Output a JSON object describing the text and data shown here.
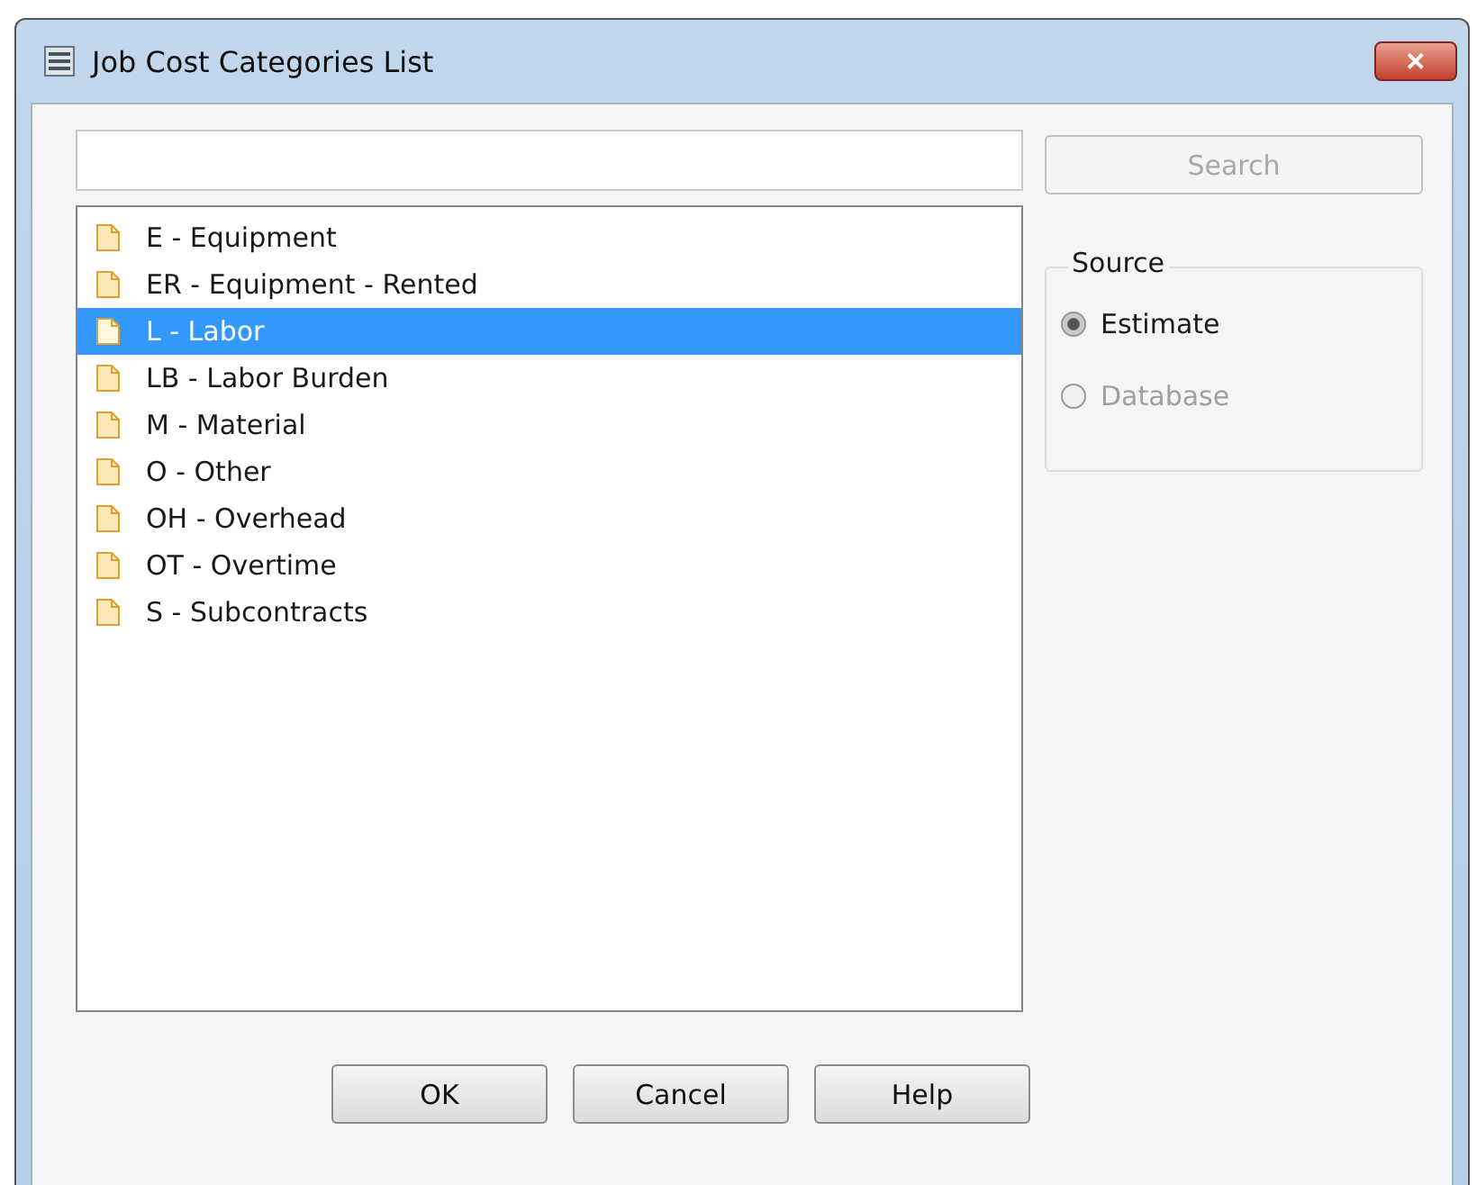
{
  "window": {
    "title": "Job Cost Categories List",
    "close_label": "✕"
  },
  "search": {
    "button": {
      "label": "Search",
      "disabled": true
    }
  },
  "items": [
    {
      "label": "E - Equipment",
      "selected": false
    },
    {
      "label": "ER - Equipment - Rented",
      "selected": false
    },
    {
      "label": "L - Labor",
      "selected": true
    },
    {
      "label": "LB - Labor Burden",
      "selected": false
    },
    {
      "label": "M - Material",
      "selected": false
    },
    {
      "label": "O - Other",
      "selected": false
    },
    {
      "label": "OH - Overhead",
      "selected": false
    },
    {
      "label": "OT - Overtime",
      "selected": false
    },
    {
      "label": "S - Subcontracts",
      "selected": false
    }
  ],
  "source": {
    "title": "Source",
    "options": [
      {
        "label": "Estimate",
        "selected": true,
        "disabled": false
      },
      {
        "label": "Database",
        "selected": false,
        "disabled": true
      }
    ]
  },
  "buttons": [
    "OK",
    "Cancel",
    "Help"
  ]
}
